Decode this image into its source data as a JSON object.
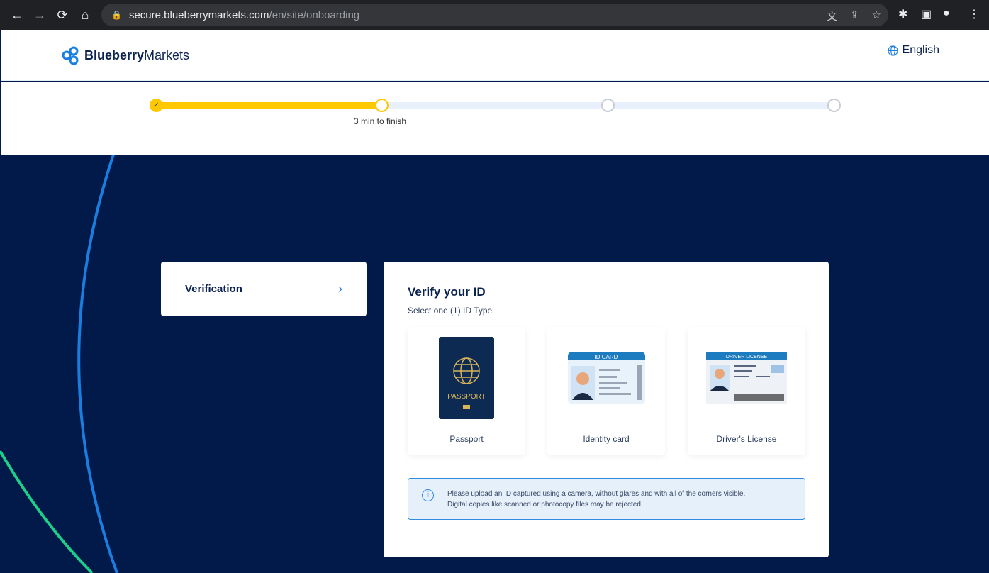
{
  "browser": {
    "url_host": "secure.blueberrymarkets.com",
    "url_path": "/en/site/onboarding"
  },
  "header": {
    "logo_bold": "Blueberry",
    "logo_rest": "Markets",
    "language": "English"
  },
  "progress": {
    "steps": 4,
    "completed": 1,
    "current": 2,
    "time_text": "3 min to finish",
    "accent": "#ffc800"
  },
  "sidebar": {
    "items": [
      {
        "label": "Verification"
      }
    ]
  },
  "main": {
    "title": "Verify your ID",
    "subtitle": "Select one (1) ID Type",
    "options": [
      {
        "label": "Passport",
        "image_text": "PASSPORT"
      },
      {
        "label": "Identity card",
        "image_text": "ID CARD"
      },
      {
        "label": "Driver's License",
        "image_text": "DRIVER LICENSE"
      }
    ],
    "notice_line1": "Please upload an ID captured using a camera, without glares and with all of the corners visible.",
    "notice_line2": "Digital copies like scanned or photocopy files may be rejected."
  },
  "colors": {
    "background": "#021a4a",
    "brand": "#1a7de0",
    "green": "#1ccf8a"
  }
}
